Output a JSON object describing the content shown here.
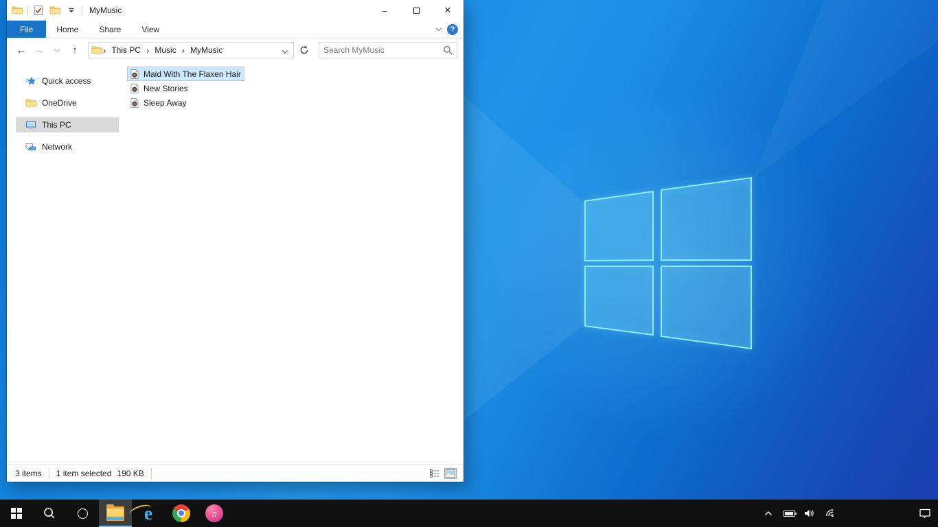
{
  "window": {
    "title": "MyMusic",
    "tabs": [
      {
        "label": "File",
        "active": true
      },
      {
        "label": "Home",
        "active": false
      },
      {
        "label": "Share",
        "active": false
      },
      {
        "label": "View",
        "active": false
      }
    ],
    "breadcrumb": {
      "segments": [
        "This PC",
        "Music",
        "MyMusic"
      ],
      "separator": "›"
    },
    "search": {
      "placeholder": "Search MyMusic"
    },
    "sidebar": {
      "items": [
        {
          "label": "Quick access",
          "icon": "quick-access-star",
          "selected": false
        },
        {
          "label": "OneDrive",
          "icon": "folder",
          "selected": false
        },
        {
          "label": "This PC",
          "icon": "monitor",
          "selected": true
        },
        {
          "label": "Network",
          "icon": "network-pc",
          "selected": false
        }
      ]
    },
    "files": [
      {
        "name": "Maid With The Flaxen Hair",
        "icon": "audio-file",
        "selected": true
      },
      {
        "name": "New Stories",
        "icon": "audio-file",
        "selected": false
      },
      {
        "name": "Sleep Away",
        "icon": "audio-file",
        "selected": false
      }
    ],
    "status": {
      "count": "3 items",
      "selected": "1 item selected",
      "size": "190 KB"
    }
  },
  "taskbar": {
    "buttons": [
      "start",
      "search",
      "cortana",
      "file-explorer",
      "internet-explorer",
      "chrome",
      "itunes"
    ],
    "active_button": "file-explorer",
    "tray": [
      "chevron-up",
      "battery",
      "volume",
      "wifi",
      "action-center"
    ]
  },
  "icons": {
    "minimize": "–",
    "close": "×",
    "help": "?",
    "back_arrow": "←",
    "forward_arrow": "→",
    "up_arrow": "↑",
    "music_note": "♫",
    "ie_letter": "e"
  },
  "colors": {
    "accent_blue": "#1973c8",
    "selection_fill": "#cce8ff",
    "selection_border": "#99d1ff",
    "sidebar_selected": "#d9d9d9",
    "taskbar": "#101010",
    "taskbar_underline": "#76b9ed",
    "wallpaper_light": "#2193e7",
    "wallpaper_dark": "#1a3fae",
    "logo_line": "#8deef8",
    "folder_yellow": "#fbd87a"
  }
}
